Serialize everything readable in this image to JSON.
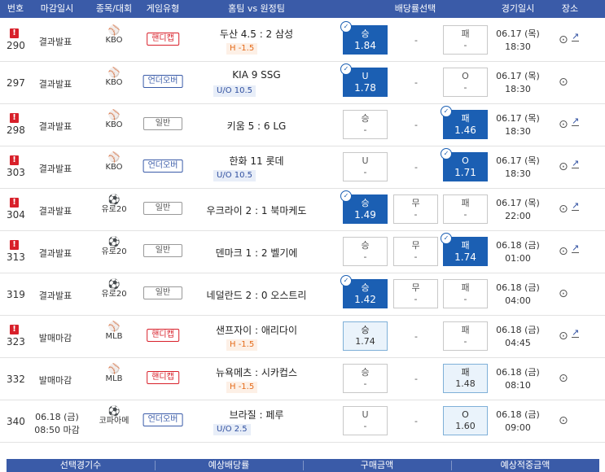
{
  "header": {
    "no": "번호",
    "deadline": "마감일시",
    "sport": "종목/대회",
    "type": "게임유형",
    "teams": "홈팀 vs 원정팀",
    "odds": "배당률선택",
    "date": "경기일시",
    "place": "장소"
  },
  "rows": [
    {
      "warn": "!",
      "no": "290",
      "status": "결과발표",
      "sport": "KBO",
      "ball": "⚾",
      "type": "핸디캡",
      "teams": "두산 4.5 : 2 삼성",
      "sub": "H -1.5",
      "win": "승",
      "win_o": "1.84",
      "draw": "-",
      "lose": "패",
      "lose_o": "-",
      "date1": "06.17 (목)",
      "date2": "18:30"
    },
    {
      "warn": "",
      "no": "297",
      "status": "결과발표",
      "sport": "KBO",
      "ball": "⚾",
      "type": "언더오버",
      "teams": "KIA   9   SSG",
      "sub": "U/O 10.5",
      "win": "U",
      "win_o": "1.78",
      "draw": "-",
      "lose": "O",
      "lose_o": "-",
      "date1": "06.17 (목)",
      "date2": "18:30"
    },
    {
      "warn": "!",
      "no": "298",
      "status": "결과발표",
      "sport": "KBO",
      "ball": "⚾",
      "type": "일반",
      "teams": "키움 5 : 6 LG",
      "sub": "",
      "win": "승",
      "win_o": "-",
      "draw": "-",
      "lose": "패",
      "lose_o": "1.46",
      "date1": "06.17 (목)",
      "date2": "18:30"
    },
    {
      "warn": "!",
      "no": "303",
      "status": "결과발표",
      "sport": "KBO",
      "ball": "⚾",
      "type": "언더오버",
      "teams": "한화   11   롯데",
      "sub": "U/O 10.5",
      "win": "U",
      "win_o": "-",
      "draw": "-",
      "lose": "O",
      "lose_o": "1.71",
      "date1": "06.17 (목)",
      "date2": "18:30"
    },
    {
      "warn": "!",
      "no": "304",
      "status": "결과발표",
      "sport": "유로20",
      "ball": "⚽",
      "type": "일반",
      "teams": "우크라이 2 : 1 북마케도",
      "sub": "",
      "win": "승",
      "win_o": "1.49",
      "draw": "무",
      "draw_o": "-",
      "lose": "패",
      "lose_o": "-",
      "date1": "06.17 (목)",
      "date2": "22:00"
    },
    {
      "warn": "!",
      "no": "313",
      "status": "결과발표",
      "sport": "유로20",
      "ball": "⚽",
      "type": "일반",
      "teams": "덴마크 1 : 2 벨기에",
      "sub": "",
      "win": "승",
      "win_o": "-",
      "draw": "무",
      "draw_o": "-",
      "lose": "패",
      "lose_o": "1.74",
      "date1": "06.18 (금)",
      "date2": "01:00"
    },
    {
      "warn": "",
      "no": "319",
      "status": "결과발표",
      "sport": "유로20",
      "ball": "⚽",
      "type": "일반",
      "teams": "네덜란드 2 : 0 오스트리",
      "sub": "",
      "win": "승",
      "win_o": "1.42",
      "draw": "무",
      "draw_o": "-",
      "lose": "패",
      "lose_o": "-",
      "date1": "06.18 (금)",
      "date2": "04:00"
    },
    {
      "warn": "!",
      "no": "323",
      "status": "발매마감",
      "sport": "MLB",
      "ball": "⚾",
      "type": "핸디캡",
      "teams": "샌프자이 : 애리다이",
      "sub": "H -1.5",
      "win": "승",
      "win_o": "1.74",
      "draw": "-",
      "lose": "패",
      "lose_o": "-",
      "date1": "06.18 (금)",
      "date2": "04:45"
    },
    {
      "warn": "",
      "no": "332",
      "status": "발매마감",
      "sport": "MLB",
      "ball": "⚾",
      "type": "핸디캡",
      "teams": "뉴욕메츠 : 시카컵스",
      "sub": "H -1.5",
      "win": "승",
      "win_o": "-",
      "draw": "-",
      "lose": "패",
      "lose_o": "1.48",
      "date1": "06.18 (금)",
      "date2": "08:10"
    },
    {
      "warn": "",
      "no": "340",
      "status1": "06.18 (금)",
      "status2": "08:50 마감",
      "sport": "코파아메",
      "ball": "⚽",
      "type": "언더오버",
      "teams": "브라질 : 페루",
      "sub": "U/O 2.5",
      "win": "U",
      "win_o": "-",
      "draw": "-",
      "lose": "O",
      "lose_o": "1.60",
      "date1": "06.18 (금)",
      "date2": "09:00"
    }
  ],
  "footer": {
    "count": "선택경기수",
    "odds": "예상배당률",
    "amount": "구매금액",
    "payout": "예상적중금액"
  },
  "icons": {
    "warn": "warning-icon",
    "loc": "location-pin-icon",
    "trend": "trend-chart-icon",
    "check": "check-icon"
  },
  "colors": {
    "header": "#3a5ba8",
    "selected": "#1b5fb3",
    "warn": "#d8202a",
    "handicap": "#e46b1a"
  }
}
